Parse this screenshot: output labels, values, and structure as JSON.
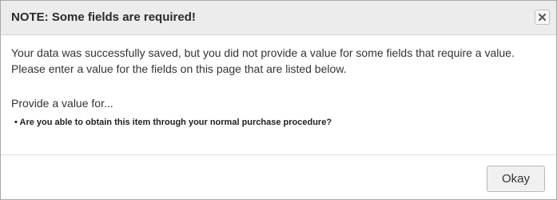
{
  "dialog": {
    "title": "NOTE: Some fields are required!",
    "close_icon": "close-icon",
    "message": "Your data was successfully saved, but you did not provide a value for some fields that require a value. Please enter a value for the fields on this page that are listed below.",
    "provide_label": "Provide a value for...",
    "fields": [
      "Are you able to obtain this item through your normal purchase procedure?"
    ],
    "okay_label": "Okay"
  }
}
